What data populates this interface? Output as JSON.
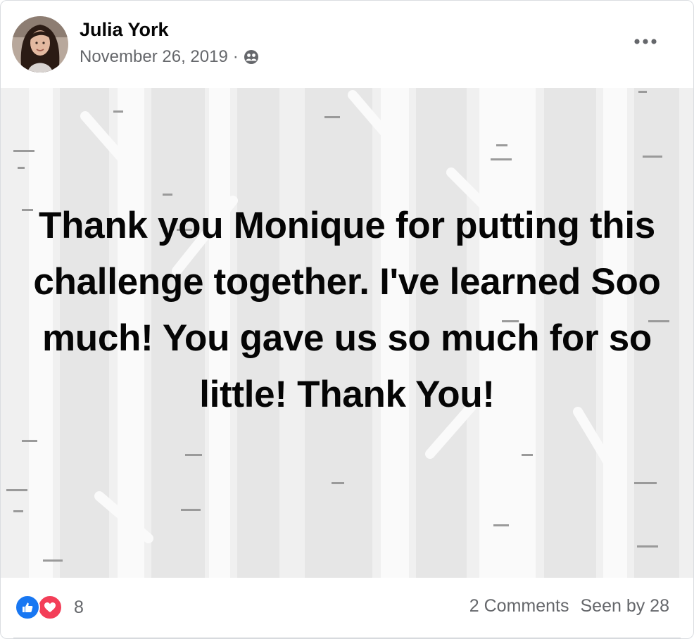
{
  "post": {
    "author": "Julia York",
    "date": "November 26, 2019",
    "separator": "·",
    "privacy_icon": "friends-icon",
    "more_icon": "ellipsis-icon",
    "status_text": "Thank you Monique for putting this challenge together. I've learned Soo much! You gave us so much for so little! Thank You!",
    "background_theme": "birch-forest"
  },
  "footer": {
    "reactions": [
      "like-icon",
      "love-icon"
    ],
    "reaction_count": "8",
    "comments": "2 Comments",
    "seen_by": "Seen by 28"
  },
  "colors": {
    "text_primary": "#050505",
    "text_secondary": "#65676b",
    "like_blue": "#1877f2",
    "love_red": "#f33e58",
    "status_background": "#f0f0f0"
  }
}
